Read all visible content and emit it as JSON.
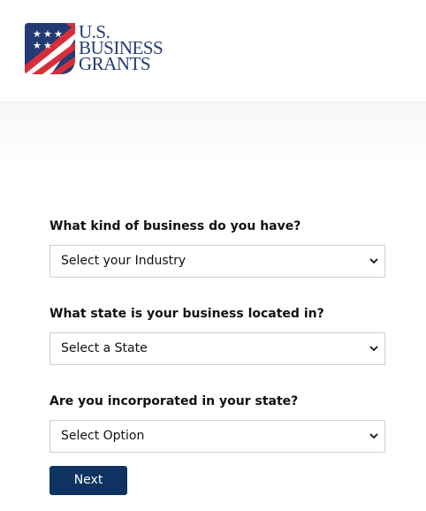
{
  "brand": {
    "line1": "U.S.",
    "line2": "BUSINESS",
    "line3": "GRANTS",
    "navy": "#243a73",
    "red": "#d62f3c"
  },
  "form": {
    "q1": {
      "label": "What kind of business do you have?",
      "selected": "Select your Industry"
    },
    "q2": {
      "label": "What state is your business located in?",
      "selected": "Select a State"
    },
    "q3": {
      "label": "Are you incorporated in your state?",
      "selected": "Select Option"
    },
    "next_label": "Next",
    "button_color": "#0f3360"
  }
}
